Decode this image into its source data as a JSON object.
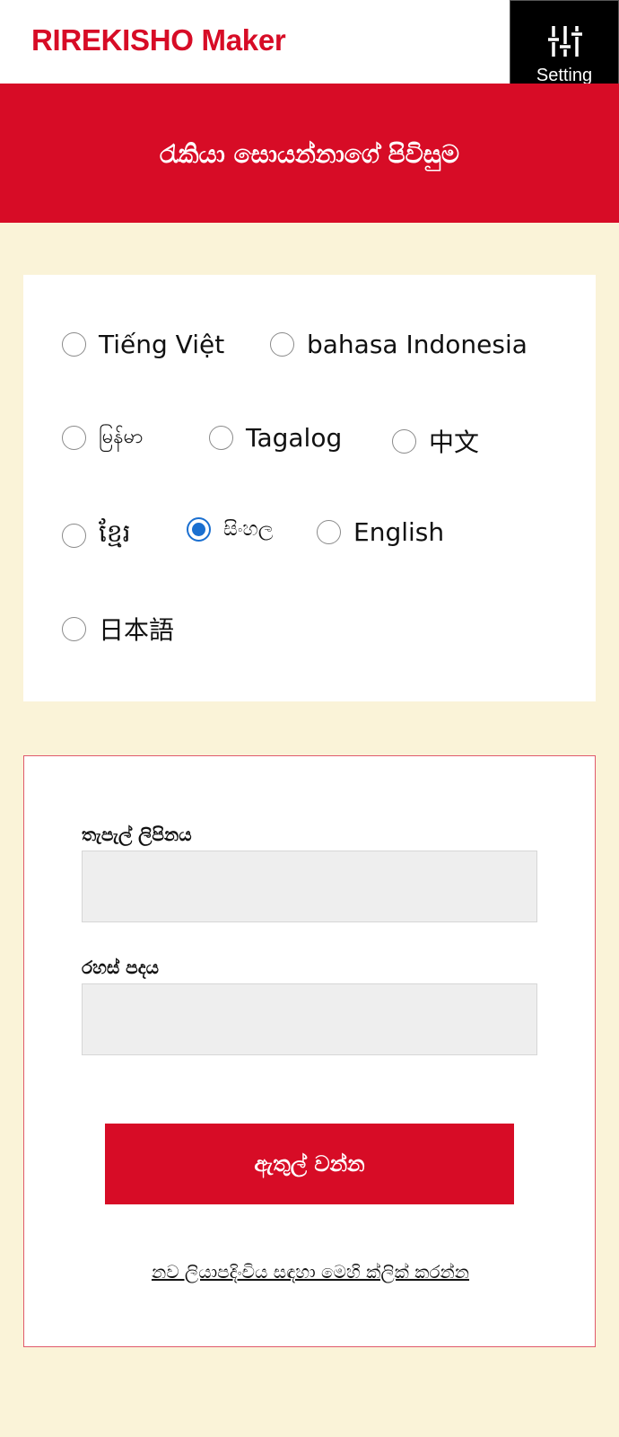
{
  "header": {
    "brand": "RIREKISHO Maker",
    "setting_label": "Setting",
    "setting_icon": "sliders-icon"
  },
  "banner": {
    "title": "රැකියා සොයන්නාගේ පිවිසුම"
  },
  "languages": {
    "selected": "sinhala",
    "options": [
      {
        "id": "vietnamese",
        "label": "Tiếng Việt"
      },
      {
        "id": "indonesian",
        "label": "bahasa Indonesia"
      },
      {
        "id": "burmese",
        "label": "မြန်မာ"
      },
      {
        "id": "tagalog",
        "label": "Tagalog"
      },
      {
        "id": "chinese",
        "label": "中文"
      },
      {
        "id": "khmer",
        "label": "ខ្មែរ"
      },
      {
        "id": "sinhala",
        "label": "සිංහල"
      },
      {
        "id": "english",
        "label": "English"
      },
      {
        "id": "japanese",
        "label": "日本語"
      }
    ]
  },
  "login": {
    "email_label": "තැපැල් ලිපිනය",
    "email_value": "",
    "password_label": "රහස් පදය",
    "password_value": "",
    "submit_label": "ඇතුල් වන්න",
    "register_link": "නව ලියාපදිංචිය සඳහා මෙහි ක්ලික් කරන්න"
  },
  "colors": {
    "brand_red": "#d70c26",
    "background": "#faf3d8",
    "radio_selected": "#1a6fd0"
  }
}
